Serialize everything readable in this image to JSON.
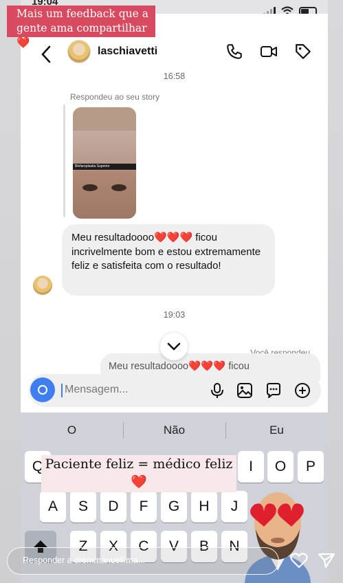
{
  "status": {
    "time": "19:04"
  },
  "banner": {
    "line1": "Mais um feedback que a",
    "line2": "gente ama compartilhar",
    "heart": "❤️"
  },
  "header": {
    "username": "laschiavetti",
    "icons": [
      "back-chevron-icon",
      "phone-icon",
      "video-icon",
      "tag-icon"
    ]
  },
  "thread": {
    "time1": "16:58",
    "story_reply_label": "Respondeu ao seu story",
    "story_band_text": "Blefaroplastia Superior",
    "message1": {
      "part1": "Meu resultadoooo",
      "hearts": "❤️❤️❤️",
      "part2": " ficou incrivelmente bom e estou extremamente feliz e satisfeita com o resultado!"
    },
    "time2": "19:03",
    "you_replied_label": "Você respondeu",
    "peek_text": "Meu resultadoooo❤️❤️❤️ ficou"
  },
  "composer": {
    "placeholder": "Mensagem...",
    "icons": [
      "camera-icon",
      "mic-icon",
      "image-icon",
      "sticker-icon",
      "plus-icon"
    ]
  },
  "keyboard": {
    "suggestions": [
      "O",
      "Não",
      "Eu"
    ],
    "row1_visible": [
      "I",
      "O",
      "P"
    ],
    "row2": [
      "A",
      "S",
      "D",
      "F",
      "G",
      "H",
      "J"
    ],
    "row3": [
      "Z",
      "X",
      "C",
      "V",
      "B",
      "N"
    ]
  },
  "overlay": {
    "line1": "Paciente feliz = médico feliz",
    "heart": "❤️"
  },
  "reply_bar": {
    "placeholder": "Responder a dremmanuellima..."
  },
  "colors": {
    "banner": "#d84a5f",
    "accent": "#3f7ef0",
    "bubble": "#efefef"
  }
}
